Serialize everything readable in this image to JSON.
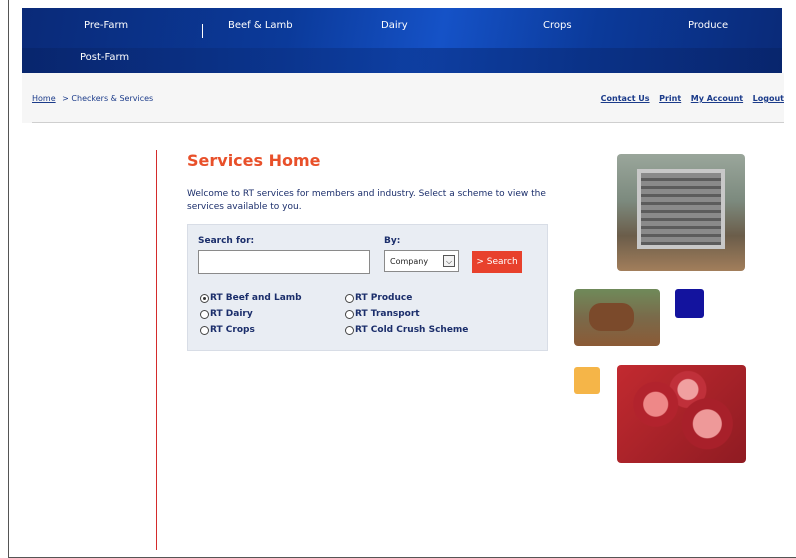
{
  "nav": {
    "items": [
      "Pre-Farm",
      "Beef & Lamb",
      "Dairy",
      "Crops",
      "Produce",
      "Post-Farm"
    ]
  },
  "breadcrumb": {
    "home": "Home",
    "current": "> Checkers & Services"
  },
  "toplinks": [
    "Contact Us",
    "Print",
    "My Account",
    "Logout"
  ],
  "main": {
    "title": "Services Home",
    "welcome": "Welcome to RT services for members and industry. Select a scheme to view the services available to you."
  },
  "search": {
    "search_label": "Search for:",
    "input_value": "",
    "by_label": "By:",
    "by_selected": "Company",
    "button_label": "> Search",
    "schemes": [
      {
        "label": "RT Beef and Lamb",
        "checked": true
      },
      {
        "label": "RT Dairy",
        "checked": false
      },
      {
        "label": "RT Crops",
        "checked": false
      },
      {
        "label": "RT Produce",
        "checked": false
      },
      {
        "label": "RT Transport",
        "checked": false
      },
      {
        "label": "RT Cold Crush Scheme",
        "checked": false
      }
    ]
  },
  "colors": {
    "nav_blue": "#0b3a9a",
    "accent_red": "#e8502a",
    "search_button": "#e8412c",
    "square_blue": "#13139e",
    "square_yellow": "#f5b548"
  }
}
